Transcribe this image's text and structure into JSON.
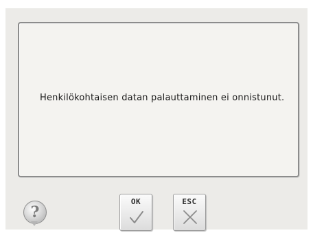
{
  "dialog": {
    "message": "Henkilökohtaisen datan palauttaminen ei onnistunut."
  },
  "buttons": {
    "help": {
      "glyph": "?",
      "icon": "question-icon"
    },
    "ok": {
      "label": "OK",
      "icon": "checkmark-icon"
    },
    "esc": {
      "label": "ESC",
      "icon": "close-icon"
    }
  },
  "colors": {
    "background": "#ecebe8",
    "panel": "#f4f3f0",
    "panel_border": "#8c8c8c",
    "text": "#1a1a1a",
    "icon_gray": "#8b8b8b"
  }
}
